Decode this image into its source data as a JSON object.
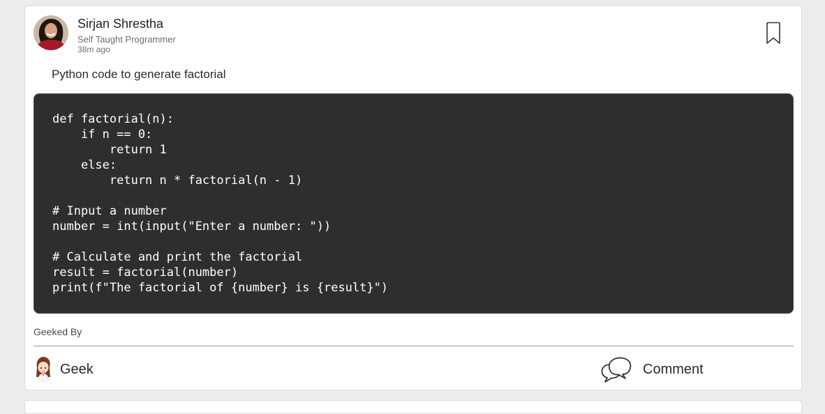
{
  "post": {
    "author": {
      "name": "Sirjan Shrestha",
      "role": "Self Taught Programmer",
      "time": "38m ago",
      "avatar_icon": "user-photo"
    },
    "text": "Python code to generate factorial",
    "code_lines": [
      "def factorial(n):",
      "    if n == 0:",
      "        return 1",
      "    else:",
      "        return n * factorial(n - 1)",
      "",
      "# Input a number",
      "number = int(input(\"Enter a number: \"))",
      "",
      "# Calculate and print the factorial",
      "result = factorial(number)",
      "print(f\"The factorial of {number} is {result}\")"
    ],
    "geeked_by_label": "Geeked By",
    "actions": {
      "geek_label": "Geek",
      "comment_label": "Comment"
    }
  },
  "colors": {
    "page_background": "#ececec",
    "card_background": "#ffffff",
    "code_background": "#2e2e2e",
    "code_text": "#ffffff"
  },
  "icons": {
    "bookmark": "bookmark-icon",
    "geek": "geek-mascot-icon",
    "comment": "chat-bubbles-icon"
  }
}
